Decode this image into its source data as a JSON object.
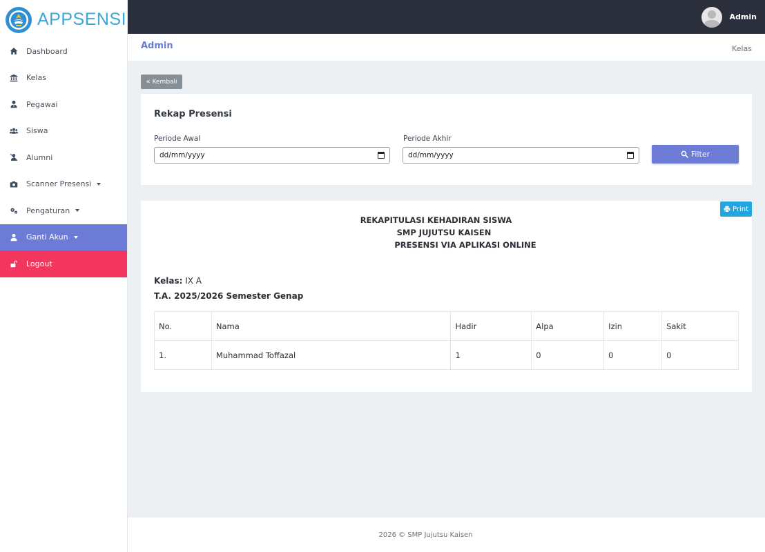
{
  "brand": {
    "name": "APPSENSI"
  },
  "sidebar": {
    "items": [
      {
        "label": "Dashboard",
        "icon": "home-icon"
      },
      {
        "label": "Kelas",
        "icon": "bank-icon"
      },
      {
        "label": "Pegawai",
        "icon": "user-tie-icon"
      },
      {
        "label": "Siswa",
        "icon": "users-icon"
      },
      {
        "label": "Alumni",
        "icon": "user-slash-icon"
      },
      {
        "label": "Scanner Presensi",
        "icon": "camera-icon"
      },
      {
        "label": "Pengaturan",
        "icon": "cogs-icon"
      },
      {
        "label": "Ganti Akun",
        "icon": "user-icon"
      },
      {
        "label": "Logout",
        "icon": "unlock-icon"
      }
    ]
  },
  "topbar": {
    "user_name": "Admin"
  },
  "header": {
    "title": "Admin",
    "breadcrumb": "Kelas"
  },
  "back_button": {
    "label": "Kembali"
  },
  "filter_card": {
    "title": "Rekap Presensi",
    "start_label": "Periode Awal",
    "start_value": "dd/mm/yyyy",
    "end_label": "Periode Akhir",
    "end_value": "dd/mm/yyyy",
    "filter_label": "Filter"
  },
  "report": {
    "print_label": "Print",
    "heading_line1": "REKAPITULASI KEHADIRAN SISWA",
    "heading_line2": "SMP JUJUTSU KAISEN",
    "heading_line3": "PRESENSI VIA APLIKASI ONLINE",
    "kelas_label": "Kelas:",
    "kelas_value": "IX A",
    "tahun_ajaran": "T.A. 2025/2026 Semester Genap",
    "columns": [
      "No.",
      "Nama",
      "Hadir",
      "Alpa",
      "Izin",
      "Sakit"
    ],
    "rows": [
      [
        "1.",
        "Muhammad Toffazal",
        "1",
        "0",
        "0",
        "0"
      ]
    ]
  },
  "footer": {
    "text": "2026 © SMP Jujutsu Kaisen"
  },
  "colors": {
    "accent": "#6c7bd6",
    "logout": "#f2365e",
    "topbar": "#2b2f3b",
    "print": "#22a6e0"
  }
}
